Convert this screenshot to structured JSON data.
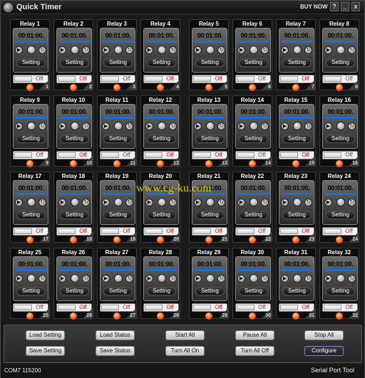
{
  "window": {
    "title": "Quick Timer",
    "buy_now": "BUY NOW",
    "help": "?",
    "minimize": "_",
    "close": "x"
  },
  "relay_defaults": {
    "time": "00:01:00.",
    "setting_label": "Setting",
    "toggle_label": "Off"
  },
  "relays": [
    {
      "label": "Relay 1",
      "number": "1"
    },
    {
      "label": "Relay 2",
      "number": "2"
    },
    {
      "label": "Relay 3",
      "number": "3"
    },
    {
      "label": "Relay 4",
      "number": "4"
    },
    {
      "label": "Relay 5",
      "number": "5"
    },
    {
      "label": "Relay 6",
      "number": "6"
    },
    {
      "label": "Relay 7",
      "number": "7"
    },
    {
      "label": "Relay 8",
      "number": "8"
    },
    {
      "label": "Relay 9",
      "number": "9"
    },
    {
      "label": "Relay 10",
      "number": "10"
    },
    {
      "label": "Relay 11",
      "number": "11"
    },
    {
      "label": "Relay 12",
      "number": "12"
    },
    {
      "label": "Relay 13",
      "number": "13"
    },
    {
      "label": "Relay 14",
      "number": "14"
    },
    {
      "label": "Relay 15",
      "number": "15"
    },
    {
      "label": "Relay 16",
      "number": "16"
    },
    {
      "label": "Relay 17",
      "number": "17"
    },
    {
      "label": "Relay 18",
      "number": "18"
    },
    {
      "label": "Relay 19",
      "number": "19"
    },
    {
      "label": "Relay 20",
      "number": "20"
    },
    {
      "label": "Relay 21",
      "number": "21"
    },
    {
      "label": "Relay 22",
      "number": "22"
    },
    {
      "label": "Relay 23",
      "number": "23"
    },
    {
      "label": "Relay 24",
      "number": "24"
    },
    {
      "label": "Relay 25",
      "number": "25"
    },
    {
      "label": "Relay 26",
      "number": "26"
    },
    {
      "label": "Relay 27",
      "number": "27"
    },
    {
      "label": "Relay 28",
      "number": "28"
    },
    {
      "label": "Relay 29",
      "number": "29"
    },
    {
      "label": "Relay 30",
      "number": "30"
    },
    {
      "label": "Relay 31",
      "number": "31"
    },
    {
      "label": "Relay 32",
      "number": "32"
    }
  ],
  "actions": {
    "load_setting": "Load Setting",
    "load_status": "Load Status",
    "start_all": "Start All",
    "pause_all": "Pause All",
    "stop_all": "Stop All",
    "save_setting": "Save Setting",
    "save_status": "Save Status",
    "turn_all_on": "Turn All On",
    "turn_all_off": "Turn All Off",
    "configure": "Configure"
  },
  "status_bar": {
    "port": "COM7 115200",
    "tool": "Serial Port Tool"
  },
  "watermark": "www.cg-ku.com",
  "colors": {
    "progress": "#1a6fd6",
    "off_text": "#d01818",
    "led": "#ff5a10",
    "watermark": "#f4e000"
  },
  "icons": {
    "play": "play-icon",
    "pause": "pause-icon",
    "reset": "reset-icon",
    "led": "red-led-icon"
  }
}
